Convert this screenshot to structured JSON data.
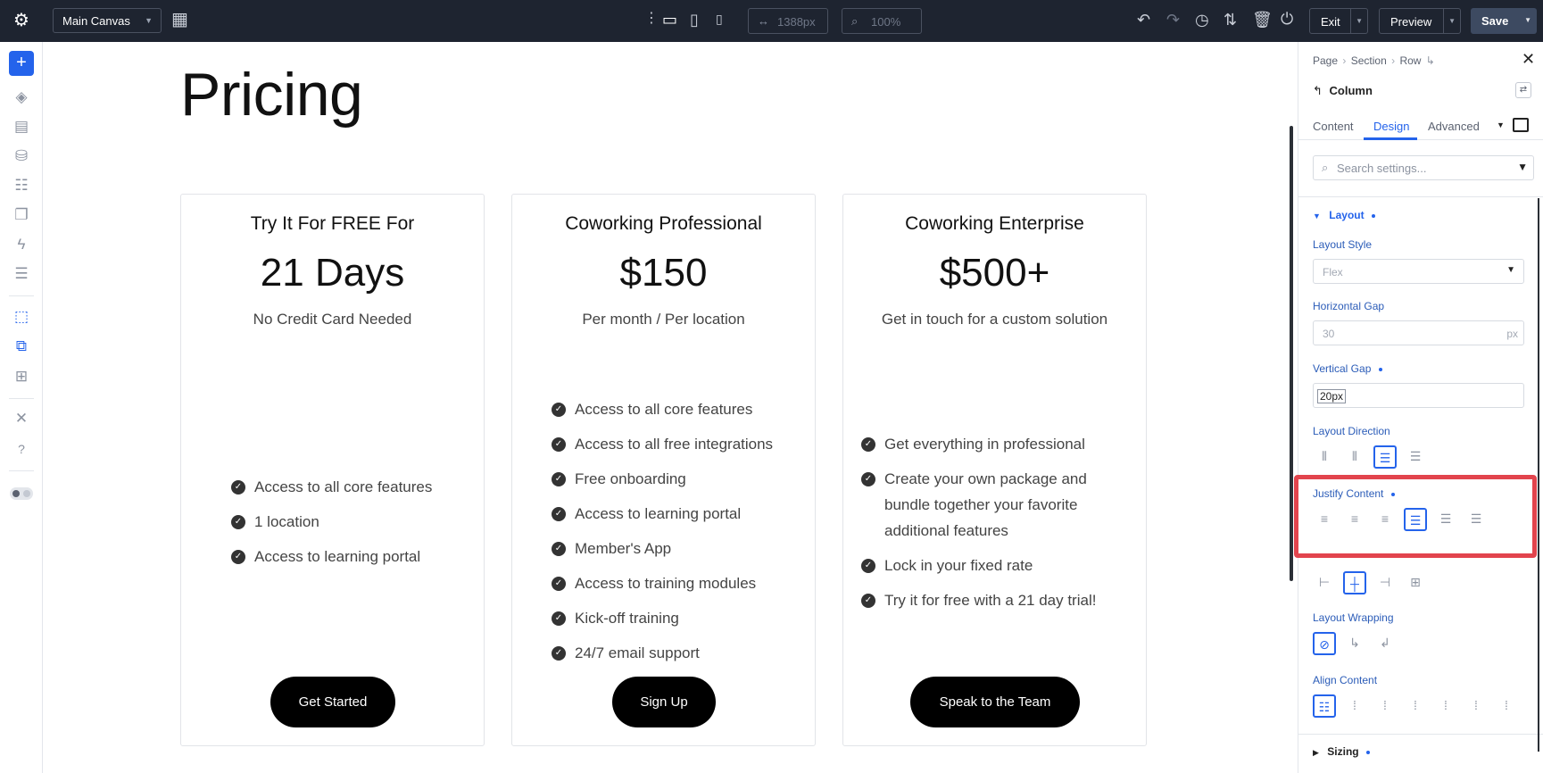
{
  "topbar": {
    "canvas_select": "Main Canvas",
    "width_value": "1388px",
    "zoom_value": "100%",
    "exit_label": "Exit",
    "preview_label": "Preview",
    "save_label": "Save"
  },
  "page": {
    "title": "Pricing",
    "cards": [
      {
        "title": "Try It For FREE For",
        "price": "21 Days",
        "subtitle": "No Credit Card Needed",
        "features": [
          "Access to all core features",
          "1 location",
          "Access to learning portal"
        ],
        "button": "Get Started"
      },
      {
        "title": "Coworking Professional",
        "price": "$150",
        "subtitle": "Per month / Per location",
        "features": [
          "Access to all core features",
          "Access to all free integrations",
          "Free onboarding",
          "Access to learning portal",
          "Member's App",
          "Access to training modules",
          "Kick-off training",
          "24/7 email support"
        ],
        "button": "Sign Up"
      },
      {
        "title": "Coworking Enterprise",
        "price": "$500+",
        "subtitle": "Get in touch for a custom solution",
        "features": [
          "Get everything in professional",
          "Create your own package and",
          "bundle together your favorite",
          "additional features",
          "Lock in your fixed rate",
          "Try it for free with a 21 day trial!"
        ],
        "button": "Speak to the Team"
      }
    ]
  },
  "panel": {
    "breadcrumb": [
      "Page",
      "Section",
      "Row"
    ],
    "element": "Column",
    "tabs": [
      "Content",
      "Design",
      "Advanced"
    ],
    "active_tab": "Design",
    "search_placeholder": "Search settings...",
    "layout_section": "Layout",
    "layout_style_label": "Layout Style",
    "layout_style_value": "Flex",
    "horizontal_gap_label": "Horizontal Gap",
    "horizontal_gap_value": "30",
    "horizontal_gap_unit": "px",
    "vertical_gap_label": "Vertical Gap",
    "vertical_gap_value": "20px",
    "layout_direction_label": "Layout Direction",
    "justify_content_label": "Justify Content",
    "layout_wrapping_label": "Layout Wrapping",
    "align_content_label": "Align Content",
    "sizing_section": "Sizing"
  },
  "colors": {
    "accent": "#2463eb",
    "highlight": "#e2444d",
    "topbar": "#1e2430"
  }
}
